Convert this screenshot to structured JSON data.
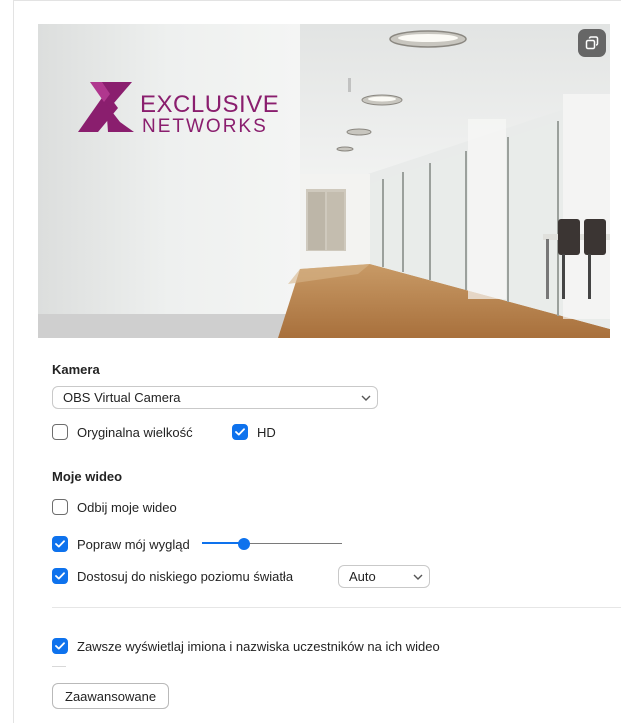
{
  "preview": {
    "logo_top": "EXCLUSIVE",
    "logo_bottom": "NETWORKS",
    "logo_color": "#8a1e6e",
    "swap_icon": "swap-camera-icon"
  },
  "camera": {
    "title": "Kamera",
    "selected": "OBS Virtual Camera",
    "original_size_label": "Oryginalna wielkość",
    "original_size_checked": false,
    "hd_label": "HD",
    "hd_checked": true
  },
  "my_video": {
    "title": "Moje wideo",
    "mirror_label": "Odbij moje wideo",
    "mirror_checked": false,
    "touch_up_label": "Popraw mój wygląd",
    "touch_up_checked": true,
    "touch_up_level": 0.3,
    "low_light_label": "Dostosuj do niskiego poziomu światła",
    "low_light_checked": true,
    "low_light_mode": "Auto"
  },
  "always_show_names_label": "Zawsze wyświetlaj imiona i nazwiska uczestników na ich wideo",
  "always_show_names_checked": true,
  "advanced_button": "Zaawansowane",
  "colors": {
    "accent": "#0e72ed"
  }
}
